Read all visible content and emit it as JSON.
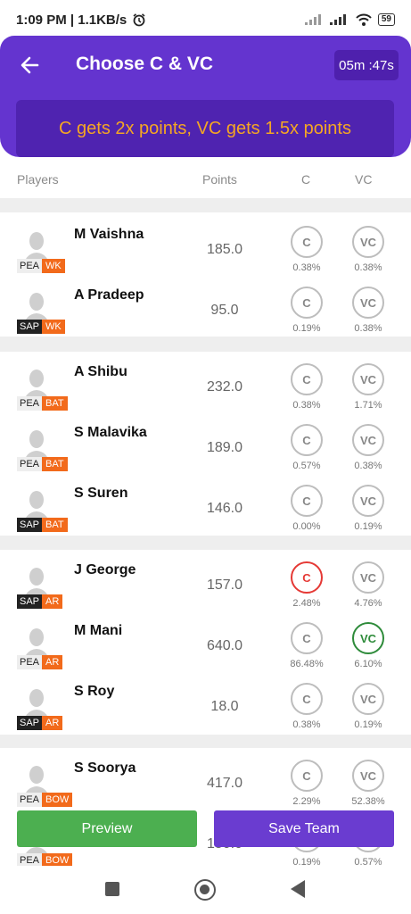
{
  "status": {
    "time_speed": "1:09 PM | 1.1KB/s",
    "battery": "59"
  },
  "header": {
    "title": "Choose C & VC",
    "timer": "05m :47s"
  },
  "banner": "C gets 2x points, VC gets 1.5x points",
  "columns": {
    "players": "Players",
    "points": "Points",
    "c": "C",
    "vc": "VC"
  },
  "cap_labels": {
    "c": "C",
    "vc": "VC"
  },
  "players": [
    {
      "name": "M Vaishna",
      "team": "PEA",
      "role": "WK",
      "points": "185.0",
      "c_pct": "0.38%",
      "vc_pct": "0.38%"
    },
    {
      "name": "A Pradeep",
      "team": "SAP",
      "role": "WK",
      "points": "95.0",
      "c_pct": "0.19%",
      "vc_pct": "0.38%"
    },
    {
      "name": "A Shibu",
      "team": "PEA",
      "role": "BAT",
      "points": "232.0",
      "c_pct": "0.38%",
      "vc_pct": "1.71%"
    },
    {
      "name": "S Malavika",
      "team": "PEA",
      "role": "BAT",
      "points": "189.0",
      "c_pct": "0.57%",
      "vc_pct": "0.38%"
    },
    {
      "name": "S Suren",
      "team": "SAP",
      "role": "BAT",
      "points": "146.0",
      "c_pct": "0.00%",
      "vc_pct": "0.19%"
    },
    {
      "name": "J George",
      "team": "SAP",
      "role": "AR",
      "points": "157.0",
      "c_pct": "2.48%",
      "vc_pct": "4.76%"
    },
    {
      "name": "M Mani",
      "team": "PEA",
      "role": "AR",
      "points": "640.0",
      "c_pct": "86.48%",
      "vc_pct": "6.10%"
    },
    {
      "name": "S Roy",
      "team": "SAP",
      "role": "AR",
      "points": "18.0",
      "c_pct": "0.38%",
      "vc_pct": "0.19%"
    },
    {
      "name": "S Soorya",
      "team": "PEA",
      "role": "BOW",
      "points": "417.0",
      "c_pct": "2.29%",
      "vc_pct": "52.38%"
    },
    {
      "name": "",
      "team": "PEA",
      "role": "BOW",
      "points": "150.0",
      "c_pct": "0.19%",
      "vc_pct": "0.57%"
    }
  ],
  "buttons": {
    "preview": "Preview",
    "save": "Save Team"
  },
  "icons": {
    "back": "back-arrow-icon",
    "alarm": "alarm-clock-icon",
    "wifi": "wifi-icon",
    "signal": "signal-icon",
    "avatar": "player-silhouette-icon"
  },
  "colors": {
    "primary": "#6434cf",
    "banner_text": "#f5a623",
    "role_badge": "#f26a1b",
    "captain_selected": "#e53935",
    "vice_captain_selected": "#2e8b3a",
    "preview_button": "#4caf50"
  }
}
